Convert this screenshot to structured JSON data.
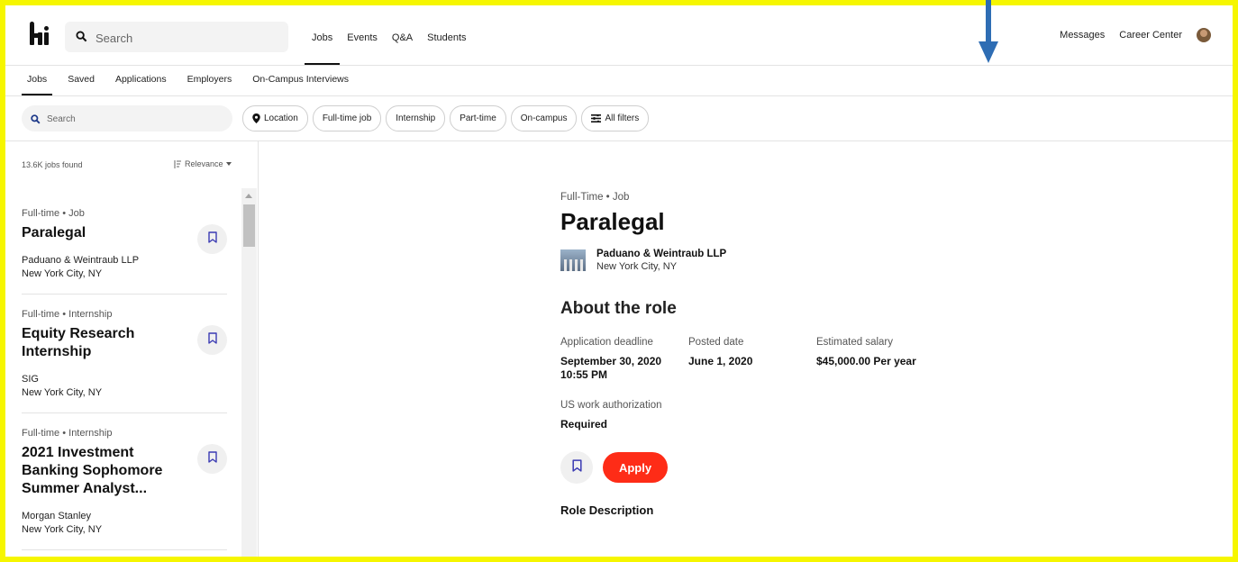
{
  "topbar": {
    "search_placeholder": "Search",
    "nav": [
      "Jobs",
      "Events",
      "Q&A",
      "Students"
    ],
    "active_nav": "Jobs",
    "right": {
      "messages": "Messages",
      "career_center": "Career Center"
    }
  },
  "subnav": {
    "items": [
      "Jobs",
      "Saved",
      "Applications",
      "Employers",
      "On-Campus Interviews"
    ],
    "active": "Jobs"
  },
  "filters": {
    "search_placeholder": "Search",
    "location": "Location",
    "fulltime": "Full-time job",
    "internship": "Internship",
    "parttime": "Part-time",
    "oncampus": "On-campus",
    "allfilters": "All filters"
  },
  "list": {
    "count": "13.6K jobs found",
    "sort": "Relevance",
    "jobs": [
      {
        "type": "Full-time • Job",
        "title": "Paralegal",
        "company": "Paduano & Weintraub LLP",
        "location": "New York City, NY"
      },
      {
        "type": "Full-time • Internship",
        "title": "Equity Research Internship",
        "company": "SIG",
        "location": "New York City, NY"
      },
      {
        "type": "Full-time • Internship",
        "title": "2021 Investment Banking Sophomore Summer Analyst...",
        "company": "Morgan Stanley",
        "location": "New York City, NY"
      }
    ]
  },
  "detail": {
    "type": "Full-Time • Job",
    "title": "Paralegal",
    "company": "Paduano & Weintraub LLP",
    "location": "New York City, NY",
    "about_heading": "About the role",
    "deadline_label": "Application deadline",
    "deadline_value": "September 30, 2020 10:55 PM",
    "posted_label": "Posted date",
    "posted_value": "June 1, 2020",
    "salary_label": "Estimated salary",
    "salary_value": "$45,000.00 Per year",
    "auth_label": "US work authorization",
    "auth_value": "Required",
    "apply_label": "Apply",
    "role_desc_heading": "Role Description"
  },
  "colors": {
    "accent": "#fe2c17",
    "frame": "#f6f600",
    "annotation_arrow": "#2e6db4",
    "bookmark": "#3b3bb3"
  }
}
